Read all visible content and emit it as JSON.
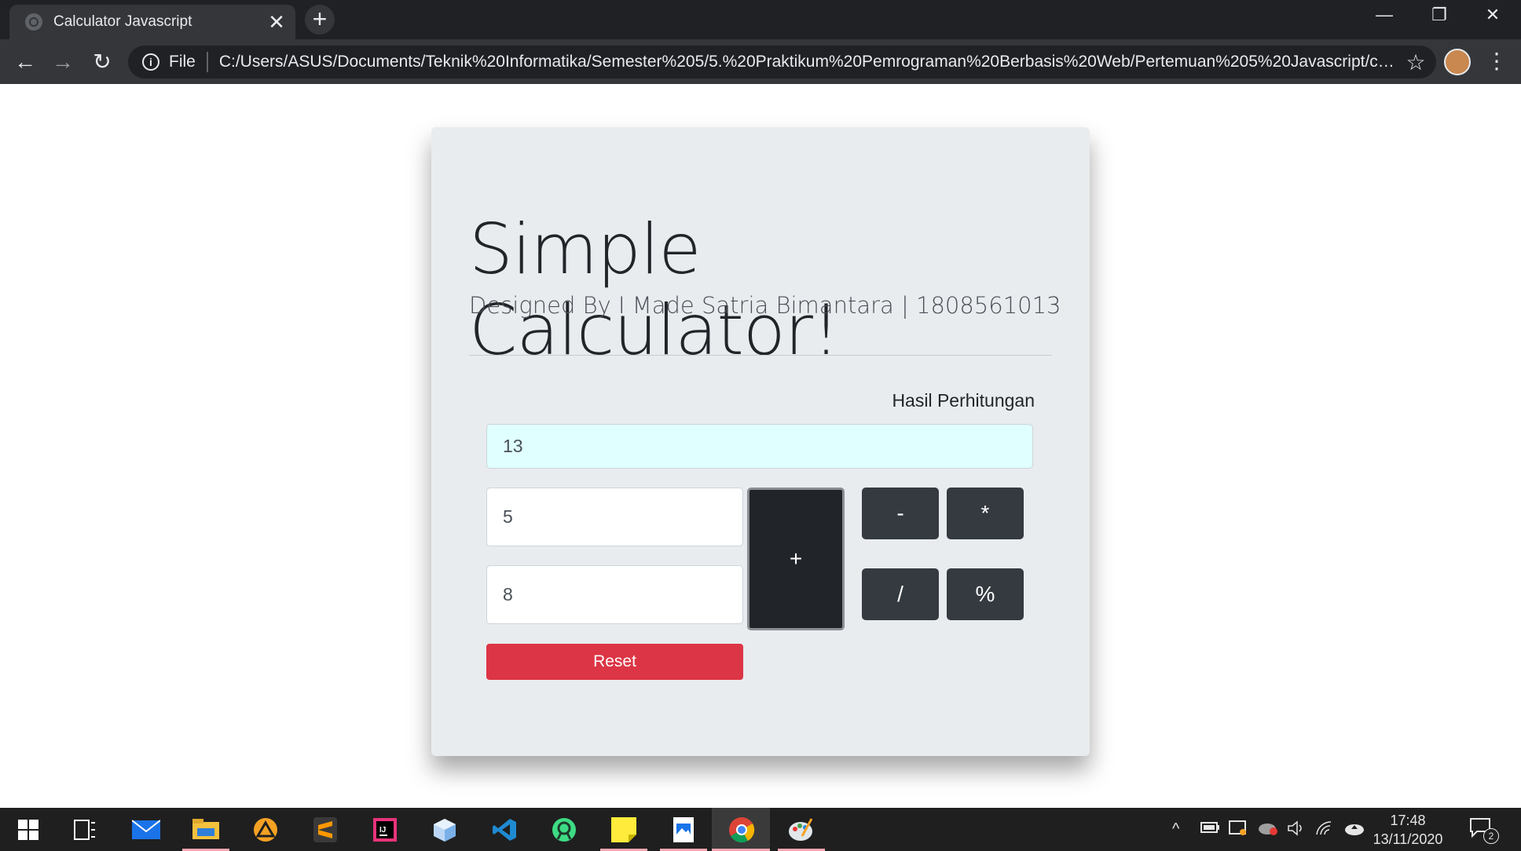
{
  "browser": {
    "tab_title": "Calculator Javascript",
    "tab_close": "✕",
    "new_tab": "+",
    "window_controls": {
      "minimize": "—",
      "restore": "❐",
      "close": "✕"
    },
    "nav": {
      "back": "←",
      "forward": "→",
      "reload": "↻"
    },
    "address": {
      "info": "i",
      "scheme_label": "File",
      "url": "C:/Users/ASUS/Documents/Teknik%20Informatika/Semester%205/5.%20Praktikum%20Pemrograman%20Berbasis%20Web/Pertemuan%205%20Javascript/cal...",
      "star": "☆"
    },
    "menu": "⋮"
  },
  "page": {
    "title": "Simple Calculator!",
    "subtitle": "Designed By I Made Satria Bimantara | 1808561013",
    "result_label": "Hasil Perhitungan",
    "result_value": "13",
    "input1_value": "5",
    "input2_value": "8",
    "buttons": {
      "add": "+",
      "subtract": "-",
      "multiply": "*",
      "divide": "/",
      "modulo": "%",
      "reset": "Reset"
    }
  },
  "taskbar": {
    "clock_time": "17:48",
    "clock_date": "13/11/2020",
    "notifications_count": "2"
  },
  "colors": {
    "card_bg": "#e9ecef",
    "result_bg": "#e0ffff",
    "button_dark": "#343a40",
    "button_active": "#212529",
    "reset_red": "#dc3545"
  }
}
